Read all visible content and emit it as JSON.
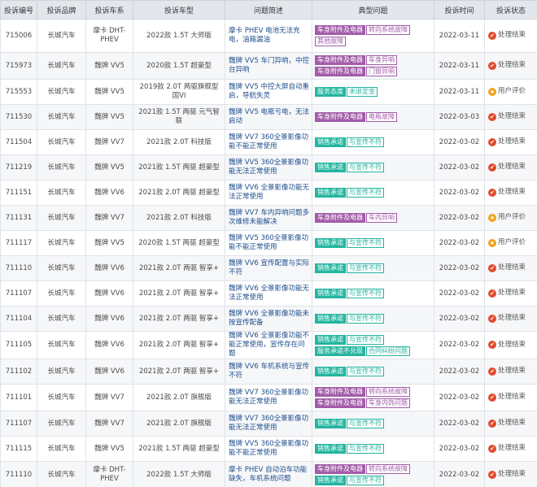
{
  "table": {
    "headers": [
      "投诉编号",
      "投诉品牌",
      "投诉车系",
      "投诉车型",
      "问题简述",
      "典型问题",
      "投诉时间",
      "投诉状态"
    ],
    "rows": [
      {
        "id": "715006",
        "brand": "长城汽车",
        "series": "摩卡 DHT-PHEV",
        "model": "2022款 1.5T 大师版",
        "problem": "摩卡 PHEV 电池无法充电，油箱漏油",
        "tags": [
          {
            "text": "车身附件及电器",
            "style": "purple-solid"
          },
          {
            "text": "转向系统故障",
            "style": "purple-outline"
          },
          {
            "text": "其他故障",
            "style": "purple-outline"
          }
        ],
        "date": "2022-03-11",
        "status": "处理结束",
        "status_type": "done"
      },
      {
        "id": "715973",
        "brand": "长城汽车",
        "series": "魏牌 VV5",
        "model": "2020款 1.5T 超豪型",
        "problem": "魏牌 VV5 车门异响，中控台异响",
        "tags": [
          {
            "text": "车身附件及电器",
            "style": "purple-solid"
          },
          {
            "text": "车身异响",
            "style": "purple-outline"
          },
          {
            "text": "车身附件及电器",
            "style": "purple-solid"
          },
          {
            "text": "门窗异响",
            "style": "purple-outline"
          }
        ],
        "date": "2022-03-11",
        "status": "处理结束",
        "status_type": "done"
      },
      {
        "id": "715553",
        "brand": "长城汽车",
        "series": "魏牌 VV5",
        "model": "2019款 2.0T 两驱旗舰型 国VI",
        "problem": "魏牌 VV5 中控大屏自动重启，导航失灵",
        "tags": [
          {
            "text": "服务态度",
            "style": "teal-solid"
          },
          {
            "text": "未退定金",
            "style": "teal-outline"
          }
        ],
        "date": "2022-03-11",
        "status": "用户评价",
        "status_type": "review"
      },
      {
        "id": "711530",
        "brand": "长城汽车",
        "series": "魏牌 VV5",
        "model": "2021款 1.5T 两驱 元气智联",
        "problem": "魏牌 VV5 电瓶亏电，无法启动",
        "tags": [
          {
            "text": "车身附件及电器",
            "style": "purple-solid"
          },
          {
            "text": "电瓶故障",
            "style": "purple-outline"
          }
        ],
        "date": "2022-03-03",
        "status": "处理结束",
        "status_type": "done"
      },
      {
        "id": "711504",
        "brand": "长城汽车",
        "series": "魏牌 VV7",
        "model": "2021款 2.0T 科技版",
        "problem": "魏牌 VV7 360全景影像功能不能正常使用",
        "tags": [
          {
            "text": "销售承诺",
            "style": "teal-solid"
          },
          {
            "text": "与宣传不符",
            "style": "teal-outline"
          }
        ],
        "date": "2022-03-02",
        "status": "处理结束",
        "status_type": "done"
      },
      {
        "id": "711219",
        "brand": "长城汽车",
        "series": "魏牌 VV5",
        "model": "2021款 1.5T 两驱 超豪型",
        "problem": "魏牌 VV5 360全景影像功能无法正常使用",
        "tags": [
          {
            "text": "销售承诺",
            "style": "teal-solid"
          },
          {
            "text": "与宣传不符",
            "style": "teal-outline"
          }
        ],
        "date": "2022-03-02",
        "status": "处理结束",
        "status_type": "done"
      },
      {
        "id": "711151",
        "brand": "长城汽车",
        "series": "魏牌 VV6",
        "model": "2021款 2.0T 两驱 超豪型",
        "problem": "魏牌 VV6 全景影像功能无法正常使用",
        "tags": [
          {
            "text": "销售承诺",
            "style": "teal-solid"
          },
          {
            "text": "与宣传不符",
            "style": "teal-outline"
          }
        ],
        "date": "2022-03-02",
        "status": "处理结束",
        "status_type": "done"
      },
      {
        "id": "711131",
        "brand": "长城汽车",
        "series": "魏牌 VV7",
        "model": "2021款 2.0T 科技版",
        "problem": "魏牌 VV7 车内异响问题多次维修未能解决",
        "tags": [
          {
            "text": "车身附件及电器",
            "style": "purple-solid"
          },
          {
            "text": "车内异响",
            "style": "purple-outline"
          }
        ],
        "date": "2022-03-02",
        "status": "用户评价",
        "status_type": "review"
      },
      {
        "id": "711117",
        "brand": "长城汽车",
        "series": "魏牌 VV5",
        "model": "2020款 1.5T 两驱 超豪型",
        "problem": "魏牌 VV5 360全景影像功能不能正常使用",
        "tags": [
          {
            "text": "销售承诺",
            "style": "teal-solid"
          },
          {
            "text": "与宣传不符",
            "style": "teal-outline"
          }
        ],
        "date": "2022-03-02",
        "status": "用户评价",
        "status_type": "review"
      },
      {
        "id": "711110",
        "brand": "长城汽车",
        "series": "魏牌 VV6",
        "model": "2021款 2.0T 两驱 智享+",
        "problem": "魏牌 VV6 宣传配置与实际不符",
        "tags": [
          {
            "text": "销售承诺",
            "style": "teal-solid"
          },
          {
            "text": "与宣传不符",
            "style": "teal-outline"
          }
        ],
        "date": "2022-03-02",
        "status": "处理结束",
        "status_type": "done"
      },
      {
        "id": "711107",
        "brand": "长城汽车",
        "series": "魏牌 VV6",
        "model": "2021款 2.0T 两驱 智享+",
        "problem": "魏牌 VV6 全景影像功能无法正常使用",
        "tags": [
          {
            "text": "销售承诺",
            "style": "teal-solid"
          },
          {
            "text": "与宣传不符",
            "style": "teal-outline"
          }
        ],
        "date": "2022-03-02",
        "status": "处理结束",
        "status_type": "done"
      },
      {
        "id": "711104",
        "brand": "长城汽车",
        "series": "魏牌 VV6",
        "model": "2021款 2.0T 两驱 智享+",
        "problem": "魏牌 VV6 全景影像功能未按宣传配备",
        "tags": [
          {
            "text": "销售承诺",
            "style": "teal-solid"
          },
          {
            "text": "与宣传不符",
            "style": "teal-outline"
          }
        ],
        "date": "2022-03-02",
        "status": "处理结束",
        "status_type": "done"
      },
      {
        "id": "711105",
        "brand": "长城汽车",
        "series": "魏牌 VV6",
        "model": "2021款 2.0T 两驱 智享+",
        "problem": "魏牌 VV6 全景影像功能不能正常使用，宣传存在问题",
        "tags": [
          {
            "text": "销售承诺",
            "style": "teal-solid"
          },
          {
            "text": "与宣传不符",
            "style": "teal-outline"
          },
          {
            "text": "服务承诺不兑现",
            "style": "teal-solid"
          },
          {
            "text": "合同纠纷问题",
            "style": "teal-outline"
          }
        ],
        "date": "2022-03-02",
        "status": "处理结束",
        "status_type": "done"
      },
      {
        "id": "711102",
        "brand": "长城汽车",
        "series": "魏牌 VV6",
        "model": "2021款 2.0T 两驱 智享+",
        "problem": "魏牌 VV6 车机系统与宣传不符",
        "tags": [
          {
            "text": "销售承诺",
            "style": "teal-solid"
          },
          {
            "text": "与宣传不符",
            "style": "teal-outline"
          }
        ],
        "date": "2022-03-02",
        "status": "处理结束",
        "status_type": "done"
      },
      {
        "id": "711101",
        "brand": "长城汽车",
        "series": "魏牌 VV7",
        "model": "2021款 2.0T 旗舰版",
        "problem": "魏牌 VV7 360全景影像功能无法正常使用",
        "tags": [
          {
            "text": "车身附件及电器",
            "style": "purple-solid"
          },
          {
            "text": "转向系统故障",
            "style": "purple-outline"
          },
          {
            "text": "车身附件及电器",
            "style": "purple-solid"
          },
          {
            "text": "车身内饰问题",
            "style": "purple-outline"
          }
        ],
        "date": "2022-03-02",
        "status": "处理结束",
        "status_type": "done"
      },
      {
        "id": "711107",
        "brand": "长城汽车",
        "series": "魏牌 VV7",
        "model": "2021款 2.0T 旗舰版",
        "problem": "魏牌 VV7 360全景影像功能无法正常使用",
        "tags": [
          {
            "text": "销售承诺",
            "style": "teal-solid"
          },
          {
            "text": "与宣传不符",
            "style": "teal-outline"
          }
        ],
        "date": "2022-03-02",
        "status": "处理结束",
        "status_type": "done"
      },
      {
        "id": "711115",
        "brand": "长城汽车",
        "series": "魏牌 VV5",
        "model": "2021款 1.5T 两驱 超豪型",
        "problem": "魏牌 VV5 360全景影像功能不能正常使用",
        "tags": [
          {
            "text": "销售承诺",
            "style": "teal-solid"
          },
          {
            "text": "与宣传不符",
            "style": "teal-outline"
          }
        ],
        "date": "2022-03-02",
        "status": "处理结束",
        "status_type": "done"
      },
      {
        "id": "711110",
        "brand": "长城汽车",
        "series": "摩卡 DHT-PHEV",
        "model": "2022款 1.5T 大师版",
        "problem": "摩卡 PHEV 自动泊车功能缺失，车机系统问题",
        "tags": [
          {
            "text": "车身附件及电器",
            "style": "purple-solid"
          },
          {
            "text": "转向系统故障",
            "style": "purple-outline"
          },
          {
            "text": "销售承诺",
            "style": "teal-solid"
          },
          {
            "text": "与宣传不符",
            "style": "teal-outline"
          }
        ],
        "date": "2022-03-02",
        "status": "处理结束",
        "status_type": "done"
      }
    ]
  },
  "status_icons": {
    "done": "check-circle-icon",
    "review": "star-circle-icon"
  },
  "colors": {
    "header_bg": "#e3e6ea",
    "tag_purple": "#a25ca8",
    "tag_teal": "#25b5a0",
    "status_done": "#e04b2e",
    "status_review": "#f0a21a",
    "link": "#1f4e8c"
  }
}
